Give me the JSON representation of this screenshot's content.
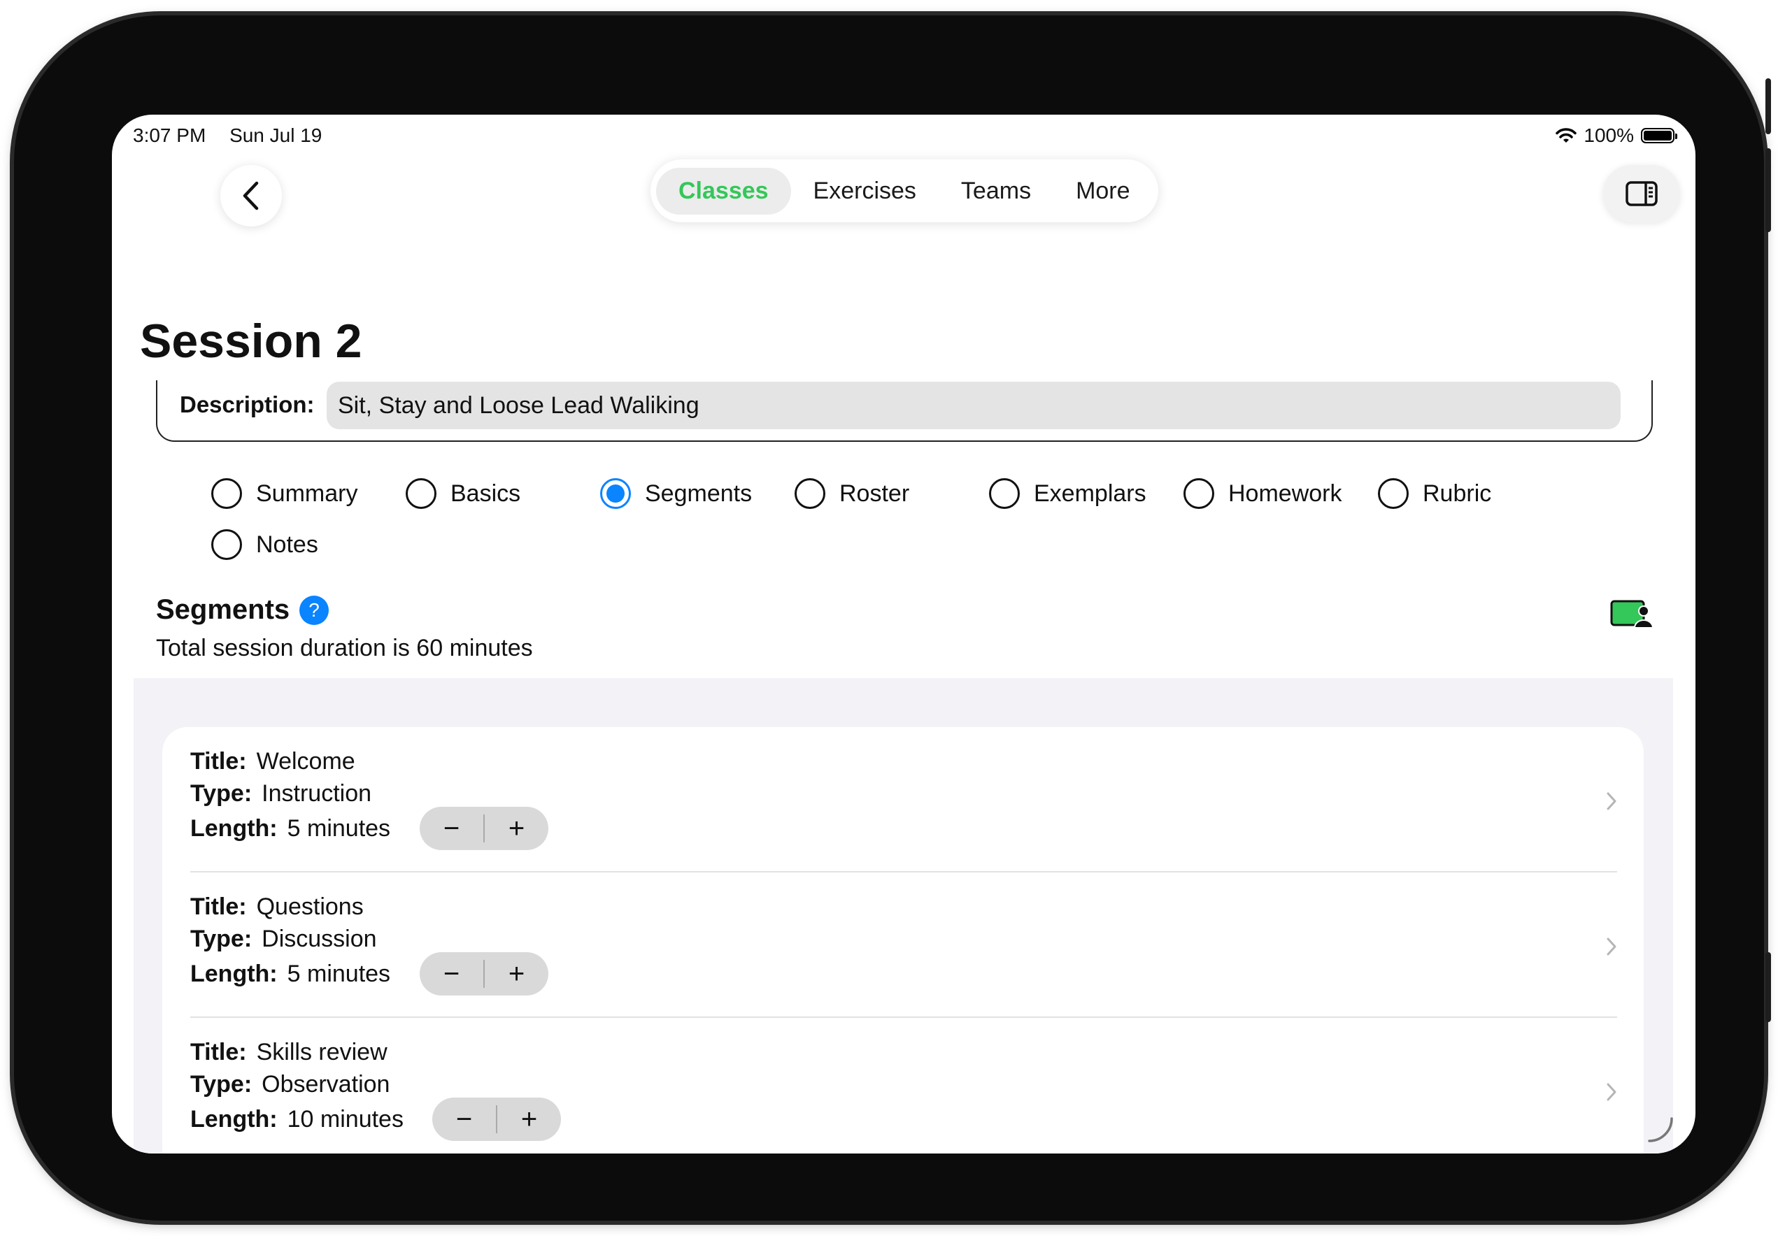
{
  "status_bar": {
    "time": "3:07 PM",
    "date": "Sun Jul 19",
    "battery": "100%"
  },
  "nav": {
    "tabs": [
      {
        "label": "Classes",
        "active": true
      },
      {
        "label": "Exercises",
        "active": false
      },
      {
        "label": "Teams",
        "active": false
      },
      {
        "label": "More",
        "active": false
      }
    ],
    "accent_color": "#34c759"
  },
  "page": {
    "title": "Session 2"
  },
  "description": {
    "label": "Description:",
    "value": "Sit, Stay and Loose Lead Waliking"
  },
  "sections": {
    "options": [
      "Summary",
      "Basics",
      "Segments",
      "Roster",
      "Exemplars",
      "Homework",
      "Rubric",
      "Notes"
    ],
    "selected": "Segments",
    "selected_color": "#0a84ff"
  },
  "segments": {
    "heading": "Segments",
    "help_glyph": "?",
    "summary": "Total session duration is 60 minutes",
    "labels": {
      "title": "Title:",
      "type": "Type:",
      "length": "Length:"
    },
    "stepper": {
      "minus": "−",
      "plus": "+"
    },
    "items": [
      {
        "title": "Welcome",
        "type": "Instruction",
        "length": "5 minutes"
      },
      {
        "title": "Questions",
        "type": "Discussion",
        "length": "5 minutes"
      },
      {
        "title": "Skills review",
        "type": "Observation",
        "length": "10 minutes"
      }
    ]
  },
  "icons": [
    "back-chevron-icon",
    "sidebar-toggle-icon",
    "help-icon",
    "present-screen-icon",
    "chevron-right-icon",
    "wifi-icon",
    "battery-icon"
  ]
}
